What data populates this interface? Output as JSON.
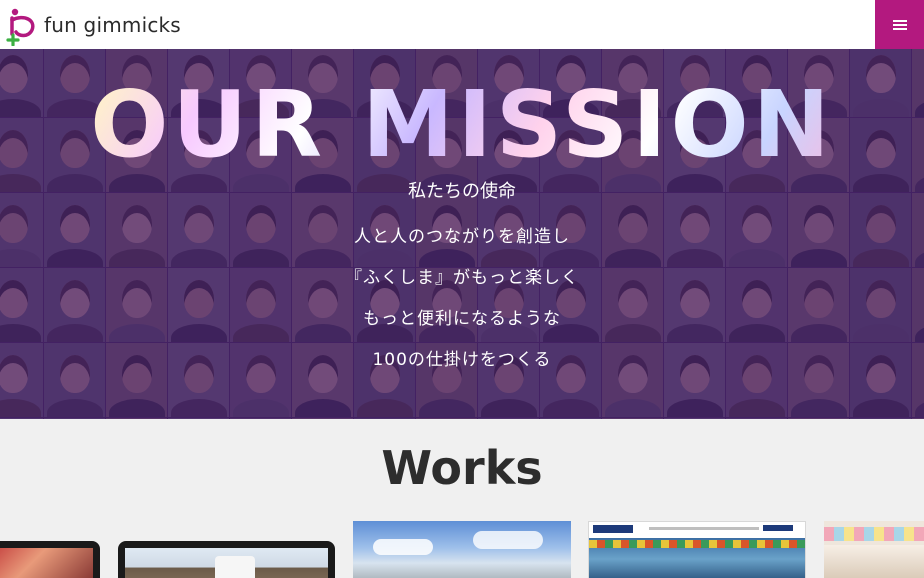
{
  "header": {
    "logo_text": "fun gimmicks",
    "logo_icon": "fun-gimmicks-logo",
    "menu_icon": "hamburger-icon",
    "menu_color": "#b3197f"
  },
  "hero": {
    "title": "OUR MISSION",
    "subtitle": "私たちの使命",
    "lines": [
      "人と人のつながりを創造し",
      "『ふくしま』がもっと楽しく",
      "もっと便利になるような",
      "100の仕掛けをつくる"
    ],
    "overlay_color": "#461e69"
  },
  "works": {
    "title": "Works"
  }
}
